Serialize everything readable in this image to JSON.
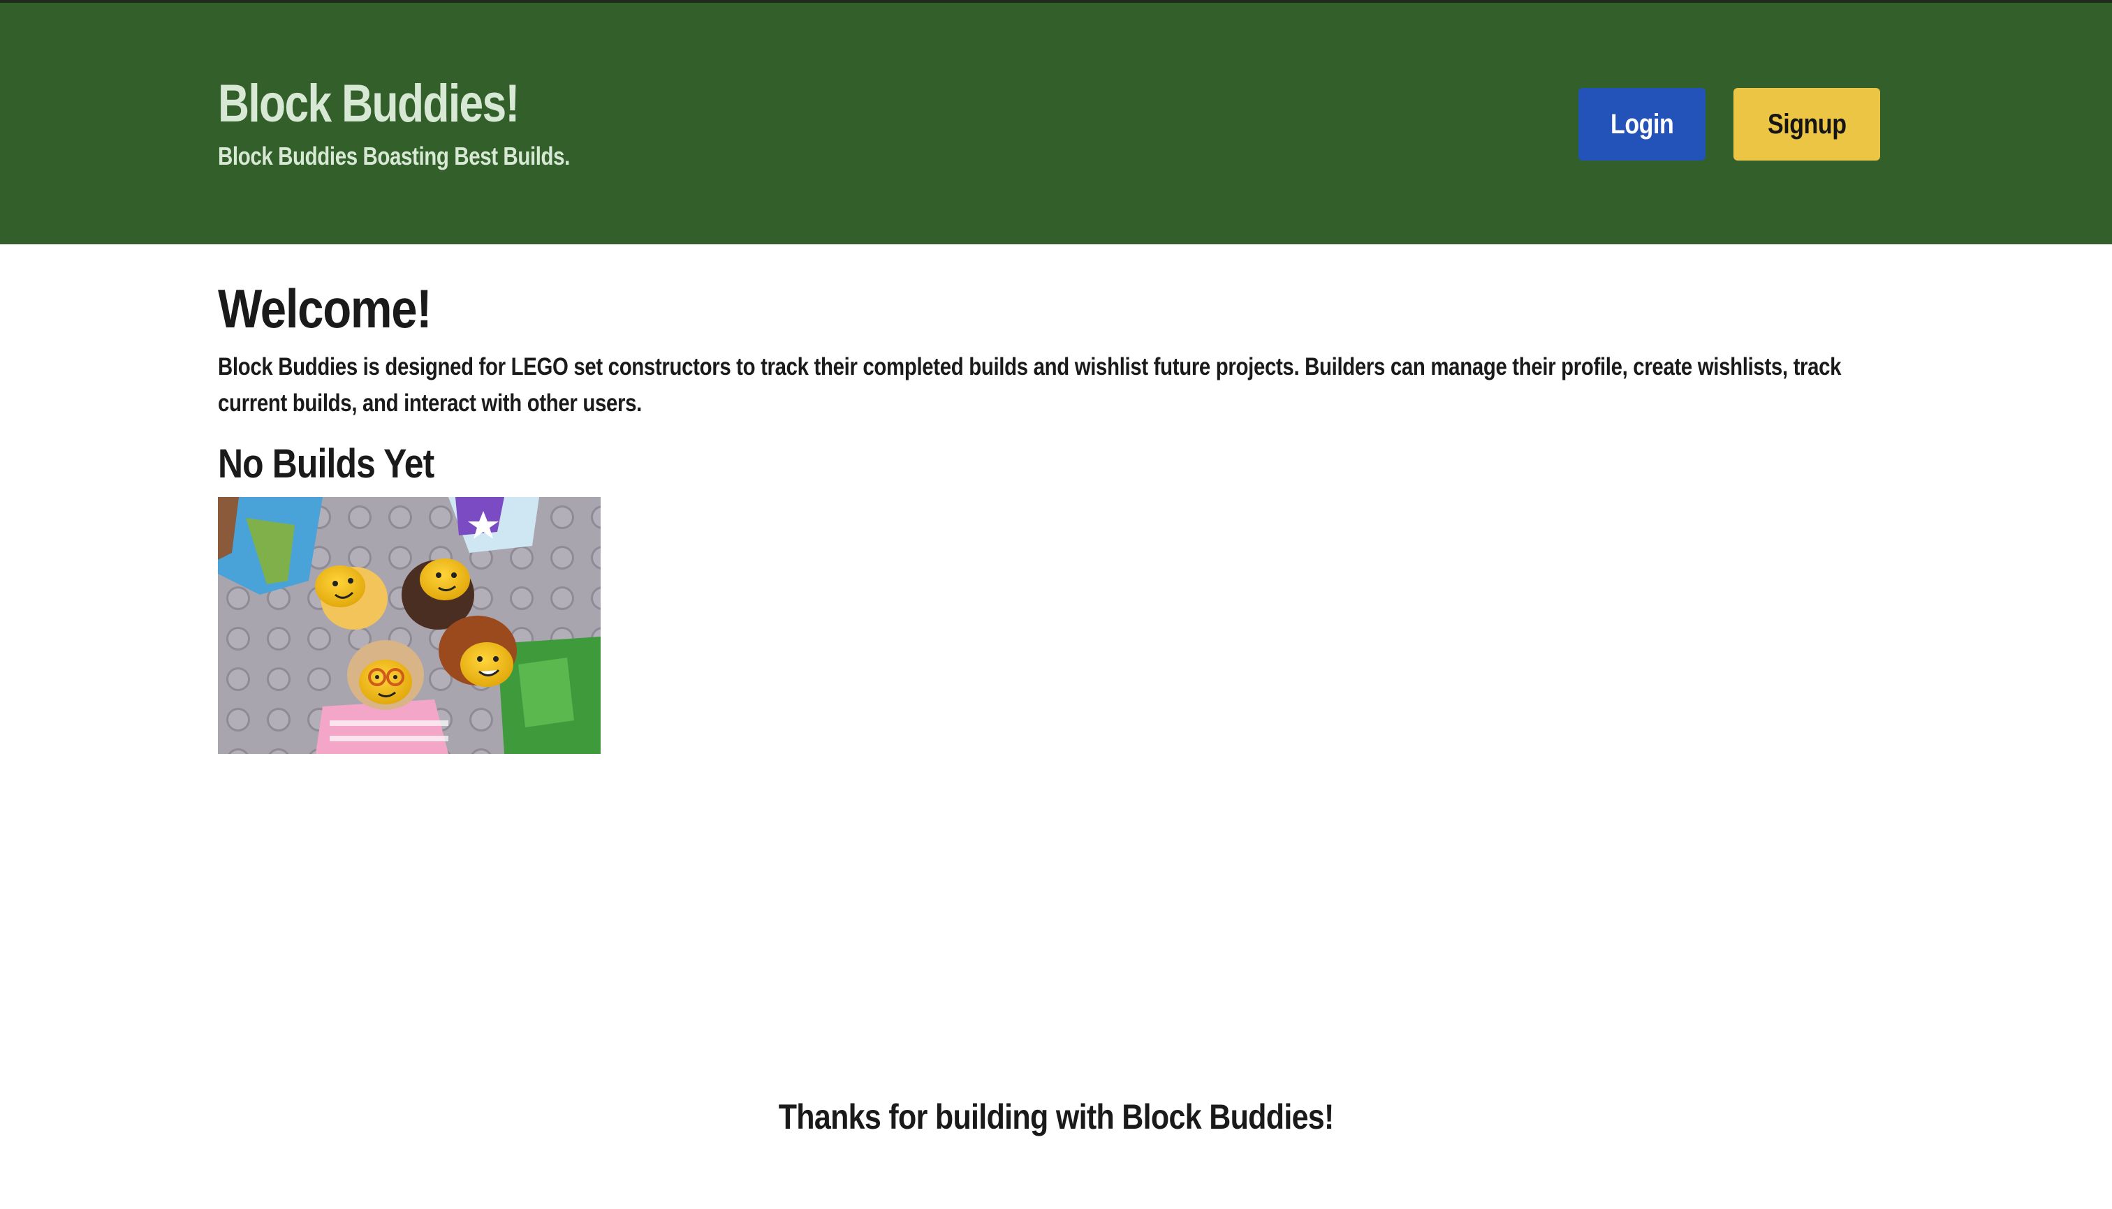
{
  "header": {
    "title": "Block Buddies!",
    "tagline": "Block Buddies Boasting Best Builds.",
    "login_label": "Login",
    "signup_label": "Signup"
  },
  "main": {
    "welcome_title": "Welcome!",
    "intro": "Block Buddies is designed for LEGO set constructors to track their completed builds and wishlist future projects. Builders can manage their profile, create wishlists, track current builds, and interact with other users.",
    "builds_heading": "No Builds Yet"
  },
  "footer": {
    "text": "Thanks for building with Block Buddies!"
  },
  "colors": {
    "header_bg": "#33602a",
    "header_text": "#d7e8d4",
    "login_button": "#2352b8",
    "signup_button": "#ecc545"
  }
}
